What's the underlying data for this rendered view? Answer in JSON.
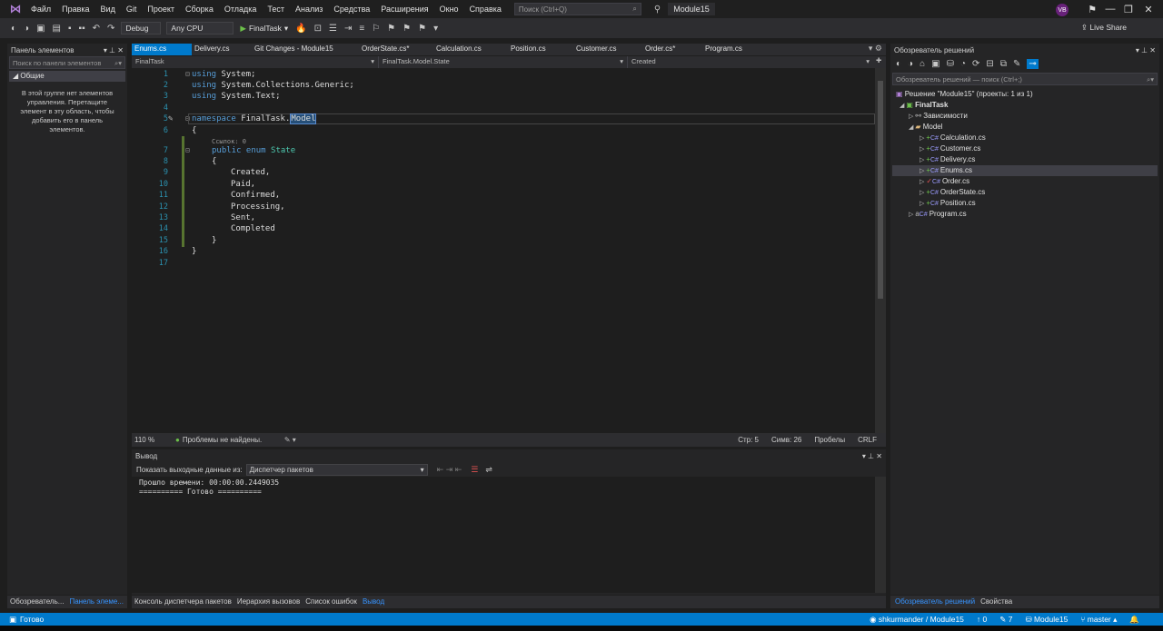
{
  "menu": {
    "items": [
      "Файл",
      "Правка",
      "Вид",
      "Git",
      "Проект",
      "Сборка",
      "Отладка",
      "Тест",
      "Анализ",
      "Средства",
      "Расширения",
      "Окно",
      "Справка"
    ],
    "search_placeholder": "Поиск (Ctrl+Q)",
    "solution_name": "Module15",
    "avatar_initials": "VB"
  },
  "toolbar": {
    "config": "Debug",
    "platform": "Any CPU",
    "run_label": "FinalTask",
    "live_share": "Live Share"
  },
  "toolbox": {
    "title": "Панель элементов",
    "search_placeholder": "Поиск по панели элементов",
    "group": "Общие",
    "empty_text": "В этой группе нет элементов управления. Перетащите элемент в эту область, чтобы добавить его в панель элементов."
  },
  "left_tabs": [
    "Обозреватель...",
    "Панель элеме..."
  ],
  "doc_tabs": [
    "Enums.cs",
    "Delivery.cs",
    "Git Changes - Module15",
    "OrderState.cs*",
    "Calculation.cs",
    "Position.cs",
    "Customer.cs",
    "Order.cs*",
    "Program.cs"
  ],
  "nav": {
    "project": "FinalTask",
    "type": "FinalTask.Model.State",
    "member": "Created"
  },
  "code": {
    "line_numbers": [
      "1",
      "2",
      "3",
      "4",
      "5",
      "6",
      "7",
      "8",
      "9",
      "10",
      "11",
      "12",
      "13",
      "14",
      "15",
      "16",
      "17"
    ],
    "using1_kw": "using",
    "using1_rest": " System;",
    "using2_kw": "using",
    "using2_rest": " System.Collections.Generic;",
    "using3_kw": "using",
    "using3_rest": " System.Text;",
    "ns_kw": "namespace",
    "ns_name": " FinalTask.",
    "ns_sel": "Model",
    "open_brace": "{",
    "codelens": "Ссылок: 0",
    "enum_kw": "public enum",
    "enum_name": " State",
    "members": [
      "Created,",
      "Paid,",
      "Confirmed,",
      "Processing,",
      "Sent,",
      "Completed"
    ],
    "close_inner": "}",
    "close_outer": "}"
  },
  "editor_status": {
    "zoom": "110 %",
    "issues": "Проблемы не найдены.",
    "line": "Стр: 5",
    "col": "Симв: 26",
    "spaces": "Пробелы",
    "eol": "CRLF"
  },
  "output": {
    "title": "Вывод",
    "show_label": "Показать выходные данные из:",
    "source": "Диспетчер пакетов",
    "lines": [
      "Прошло времени: 00:00:00.2449035",
      "========== Готово =========="
    ]
  },
  "bottom_tabs": [
    "Консоль диспетчера пакетов",
    "Иерархия вызовов",
    "Список ошибок",
    "Вывод"
  ],
  "solution": {
    "title": "Обозреватель решений",
    "search_placeholder": "Обозреватель решений — поиск (Ctrl+;)",
    "root": "Решение \"Module15\" (проекты: 1 из 1)",
    "project": "FinalTask",
    "deps": "Зависимости",
    "folder": "Model",
    "files": [
      "Calculation.cs",
      "Customer.cs",
      "Delivery.cs",
      "Enums.cs",
      "Order.cs",
      "OrderState.cs",
      "Position.cs"
    ],
    "program": "Program.cs"
  },
  "sol_tabs": [
    "Обозреватель решений",
    "Свойства"
  ],
  "statusbar": {
    "ready": "Готово",
    "repo": "shkurmander / Module15",
    "up": "0",
    "changes": "7",
    "module": "Module15",
    "branch": "master"
  }
}
